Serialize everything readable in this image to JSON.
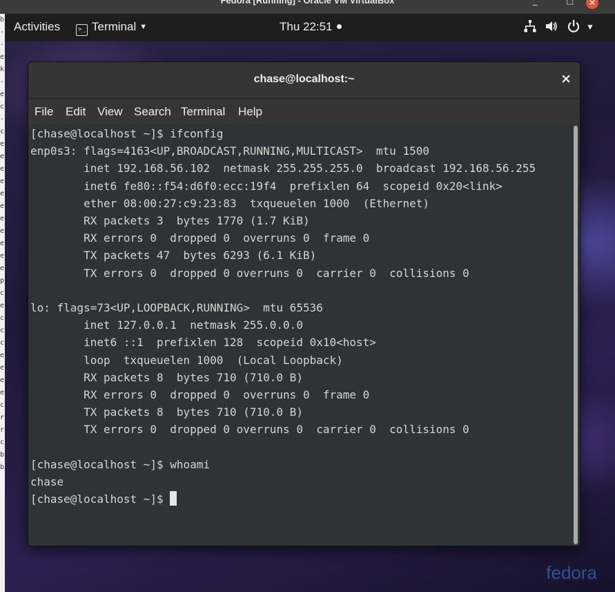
{
  "host": {
    "window_title": "Fedora [Running] - Oracle VM VirtualBox",
    "min_icon": "minimize-icon",
    "max_icon": "maximize-icon",
    "close_icon": "close-icon",
    "side_chars": [
      "b",
      "-",
      "",
      "-",
      "",
      "e",
      "",
      "k",
      "",
      "-",
      "e",
      "c",
      "-",
      "c",
      "e",
      "e",
      "e",
      "e",
      "e",
      "e",
      "e",
      "e",
      "e",
      "e",
      "e",
      "p",
      "c",
      "e",
      "c",
      "c",
      "c",
      "e",
      "e",
      "e",
      "e",
      "c",
      "r",
      "r",
      "c",
      "b",
      "b"
    ]
  },
  "topbar": {
    "activities": "Activities",
    "app_name": "Terminal",
    "clock": "Thu 22:51",
    "icons": [
      "network-icon",
      "volume-icon",
      "power-icon"
    ]
  },
  "terminal": {
    "title": "chase@localhost:~",
    "menu": [
      "File",
      "Edit",
      "View",
      "Search",
      "Terminal",
      "Help"
    ],
    "lines": [
      "[chase@localhost ~]$ ifconfig",
      "enp0s3: flags=4163<UP,BROADCAST,RUNNING,MULTICAST>  mtu 1500",
      "        inet 192.168.56.102  netmask 255.255.255.0  broadcast 192.168.56.255",
      "        inet6 fe80::f54:d6f0:ecc:19f4  prefixlen 64  scopeid 0x20<link>",
      "        ether 08:00:27:c9:23:83  txqueuelen 1000  (Ethernet)",
      "        RX packets 3  bytes 1770 (1.7 KiB)",
      "        RX errors 0  dropped 0  overruns 0  frame 0",
      "        TX packets 47  bytes 6293 (6.1 KiB)",
      "        TX errors 0  dropped 0 overruns 0  carrier 0  collisions 0",
      "",
      "lo: flags=73<UP,LOOPBACK,RUNNING>  mtu 65536",
      "        inet 127.0.0.1  netmask 255.0.0.0",
      "        inet6 ::1  prefixlen 128  scopeid 0x10<host>",
      "        loop  txqueuelen 1000  (Local Loopback)",
      "        RX packets 8  bytes 710 (710.0 B)",
      "        RX errors 0  dropped 0  overruns 0  frame 0",
      "        TX packets 8  bytes 710 (710.0 B)",
      "        TX errors 0  dropped 0 overruns 0  carrier 0  collisions 0",
      "",
      "[chase@localhost ~]$ whoami",
      "chase"
    ],
    "prompt": "[chase@localhost ~]$ "
  },
  "watermark": "fedora",
  "colors": {
    "topbar_bg": "#1e1e1e",
    "terminal_bg": "#2e3436",
    "terminal_fg": "#d3d7cf",
    "header_bg": "#353535",
    "close_red": "#e0553a"
  }
}
